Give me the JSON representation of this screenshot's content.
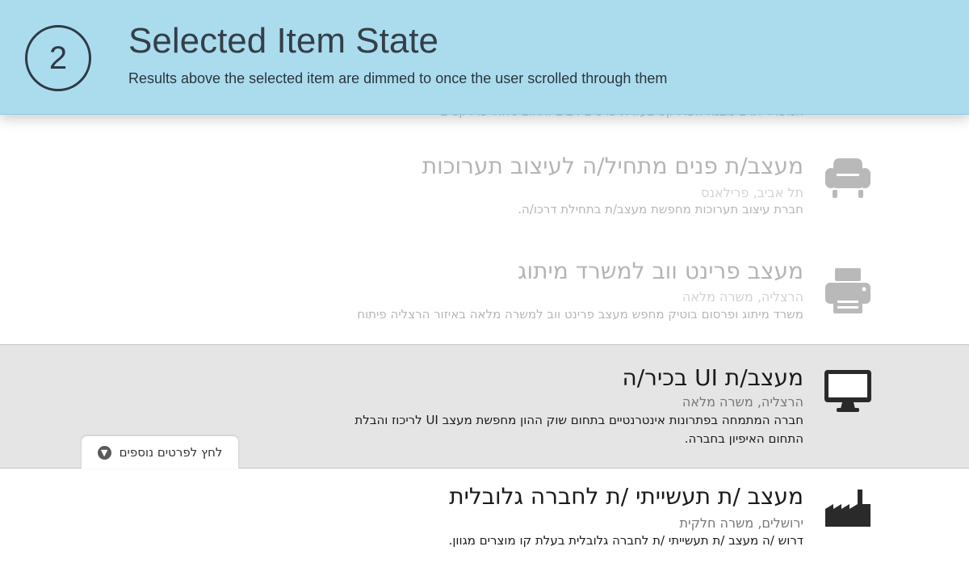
{
  "header": {
    "step_number": "2",
    "title": "Selected Item State",
    "subtitle": "Results above the selected item are dimmed to once the user scrolled through them"
  },
  "cut_off_text": "המשרד תרם מבנה הפרויקט בעזרת פרטים רבים ותחום ניהול פרויקטים",
  "listings": [
    {
      "title": "מעצב/ת פנים מתחיל/ה לעיצוב תערוכות",
      "location": "תל אביב, פרילאנס",
      "description": "חברת עיצוב תערוכות מחפשת מעצב/ת בתחילת דרכו/ה.",
      "icon": "armchair-icon",
      "state": "dimmed"
    },
    {
      "title": "מעצב פרינט ווב למשרד מיתוג",
      "location": "הרצליה, משרה מלאה",
      "description": "משרד מיתוג ופרסום בוטיק מחפש מעצב פרינט ווב למשרה מלאה באיזור הרצליה פיתוח",
      "icon": "printer-icon",
      "state": "dimmed"
    },
    {
      "title": "מעצב/ת UI בכיר/ה",
      "location": "הרצליה, משרה מלאה",
      "description_line1": "חברה המתמחה בפתרונות אינטרנטיים בתחום שוק ההון מחפשת מעצב UI לריכוז והבלת",
      "description_line2": "התחום האיפיון בחברה.",
      "icon": "monitor-icon",
      "state": "selected"
    },
    {
      "title": "מעצב /ת תעשייתי /ת לחברה גלובלית",
      "location": "ירושלים, משרה חלקית",
      "description": "דרוש /ה מעצב /ת תעשייתי /ת לחברה גלובלית בעלת קו מוצרים מגוון.",
      "icon": "factory-icon",
      "state": "normal"
    }
  ],
  "more_details": {
    "label": "לחץ לפרטים נוספים",
    "icon": "arrow-down-circle-icon"
  },
  "colors": {
    "header_bg": "#abdcee",
    "selected_bg": "#e5e5e5",
    "icon_color": "#2a2a2a"
  }
}
